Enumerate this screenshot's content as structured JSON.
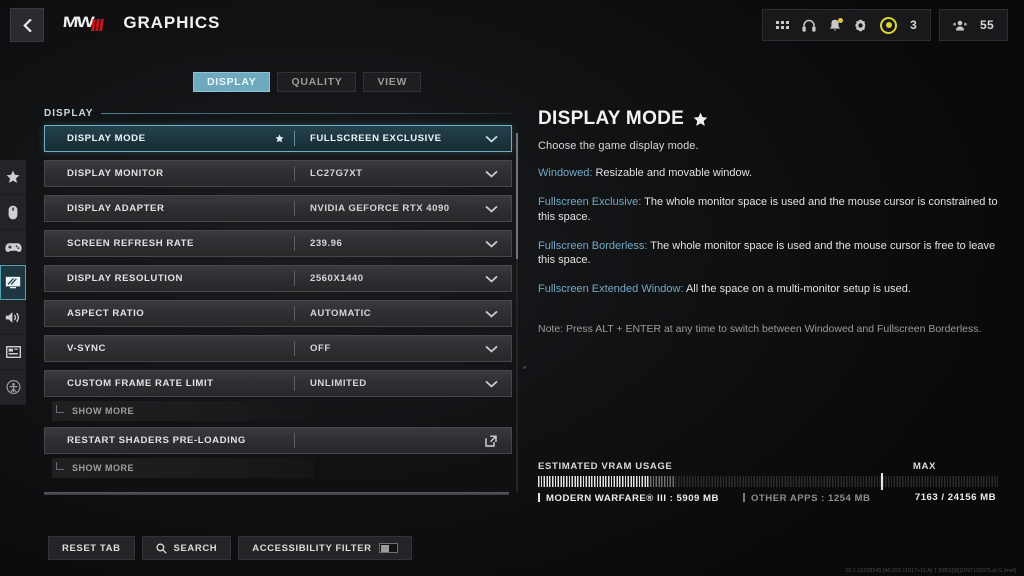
{
  "header": {
    "back_icon": "chevron-left-icon",
    "brand_mark": "MW",
    "brand_numeral": "III",
    "title": "GRAPHICS"
  },
  "status_bar": {
    "icons": [
      "apps-grid-icon",
      "headset-icon",
      "bell-icon",
      "gear-icon"
    ],
    "currency_icon": "cod-points-icon",
    "currency_value": "3",
    "players_icon": "squad-icon",
    "players_value": "55"
  },
  "rail": {
    "items": [
      {
        "name": "favorites",
        "icon": "star-icon",
        "active": false
      },
      {
        "name": "mouse-keyboard",
        "icon": "mouse-icon",
        "active": false
      },
      {
        "name": "controller",
        "icon": "gamepad-icon",
        "active": false
      },
      {
        "name": "graphics",
        "icon": "monitor-icon",
        "active": true
      },
      {
        "name": "audio",
        "icon": "speaker-icon",
        "active": false
      },
      {
        "name": "interface",
        "icon": "hud-layout-icon",
        "active": false
      },
      {
        "name": "accessibility",
        "icon": "accessibility-icon",
        "active": false
      }
    ]
  },
  "tabs": [
    {
      "label": "DISPLAY",
      "active": true
    },
    {
      "label": "QUALITY",
      "active": false
    },
    {
      "label": "VIEW",
      "active": false
    }
  ],
  "settings": {
    "section_label": "DISPLAY",
    "rows": [
      {
        "name": "DISPLAY MODE",
        "value": "FULLSCREEN EXCLUSIVE",
        "selected": true,
        "favorited": true,
        "control": "dropdown"
      },
      {
        "name": "DISPLAY MONITOR",
        "value": "LC27G7XT",
        "selected": false,
        "favorited": false,
        "control": "dropdown"
      },
      {
        "name": "DISPLAY ADAPTER",
        "value": "NVIDIA GEFORCE RTX 4090",
        "selected": false,
        "favorited": false,
        "control": "dropdown"
      },
      {
        "name": "SCREEN REFRESH RATE",
        "value": "239.96",
        "selected": false,
        "favorited": false,
        "control": "dropdown"
      },
      {
        "name": "DISPLAY RESOLUTION",
        "value": "2560X1440",
        "selected": false,
        "favorited": false,
        "control": "dropdown"
      },
      {
        "name": "ASPECT RATIO",
        "value": "AUTOMATIC",
        "selected": false,
        "favorited": false,
        "control": "dropdown"
      },
      {
        "name": "V-SYNC",
        "value": "OFF",
        "selected": false,
        "favorited": false,
        "control": "dropdown"
      },
      {
        "name": "CUSTOM FRAME RATE LIMIT",
        "value": "UNLIMITED",
        "selected": false,
        "favorited": false,
        "control": "dropdown"
      },
      {
        "name": "RESTART SHADERS PRE-LOADING",
        "value": "",
        "selected": false,
        "favorited": false,
        "control": "external-link"
      }
    ],
    "show_more_label": "SHOW MORE"
  },
  "detail": {
    "title": "DISPLAY MODE",
    "favorite_icon": "star-icon",
    "summary": "Choose the game display mode.",
    "entries": [
      {
        "term": "Windowed:",
        "text": " Resizable and movable window."
      },
      {
        "term": "Fullscreen Exclusive:",
        "text": " The whole monitor space is used and the mouse cursor is constrained to this space."
      },
      {
        "term": "Fullscreen Borderless:",
        "text": " The whole monitor space is used and the mouse cursor is free to leave this space."
      },
      {
        "term": "Fullscreen Extended Window:",
        "text": " All the space on a multi-monitor setup is used."
      }
    ],
    "note": "Note: Press ALT + ENTER at any time to switch between Windowed and Fullscreen Borderless."
  },
  "vram": {
    "label": "ESTIMATED VRAM USAGE",
    "max_label": "MAX",
    "app_legend": "MODERN WARFARE® III : 5909 MB",
    "other_legend": "OTHER APPS : 1254 MB",
    "total_legend": "7163 / 24156 MB"
  },
  "footer": {
    "reset_label": "RESET TAB",
    "search_icon": "search-icon",
    "search_label": "SEARCH",
    "accessibility_label": "ACCESSIBILITY FILTER",
    "accessibility_toggle": "off"
  },
  "build_string": "10.1.16258245 [46:255:11017+11:A] T [6851][8][1697132075.pl.G.bnet]",
  "colors": {
    "accent_teal": "#6fa9bd",
    "selected_border": "#6fb0c4",
    "brand_red": "#c3171c",
    "term_blue": "#74a9c6",
    "currency_yellow": "#d8d630"
  }
}
